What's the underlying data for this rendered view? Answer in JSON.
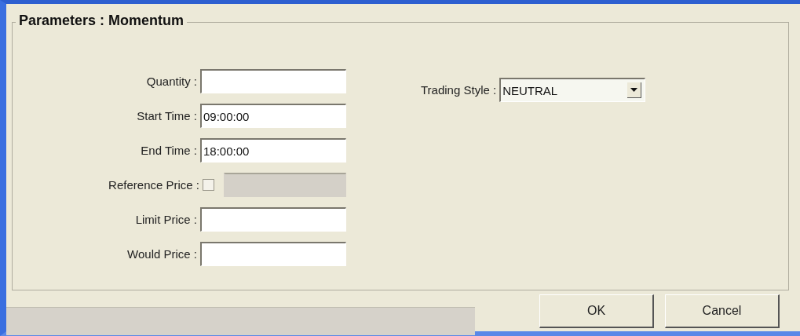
{
  "group": {
    "title": "Parameters :  Momentum"
  },
  "fields": [
    {
      "kind": "text",
      "label": "Quantity :"
    },
    {
      "kind": "text",
      "label": "Start Time :",
      "value": "09:00:00"
    },
    {
      "kind": "text",
      "label": "End Time :",
      "value": "18:00:00"
    },
    {
      "kind": "checkbox_text",
      "label": "Reference Price :",
      "checked": false,
      "disabled": true
    },
    {
      "kind": "text",
      "label": "Limit Price :"
    },
    {
      "kind": "text",
      "label": "Would Price :"
    }
  ],
  "trading_style": {
    "label": "Trading Style :",
    "value": "NEUTRAL"
  },
  "buttons": [
    "OK",
    "Cancel"
  ]
}
